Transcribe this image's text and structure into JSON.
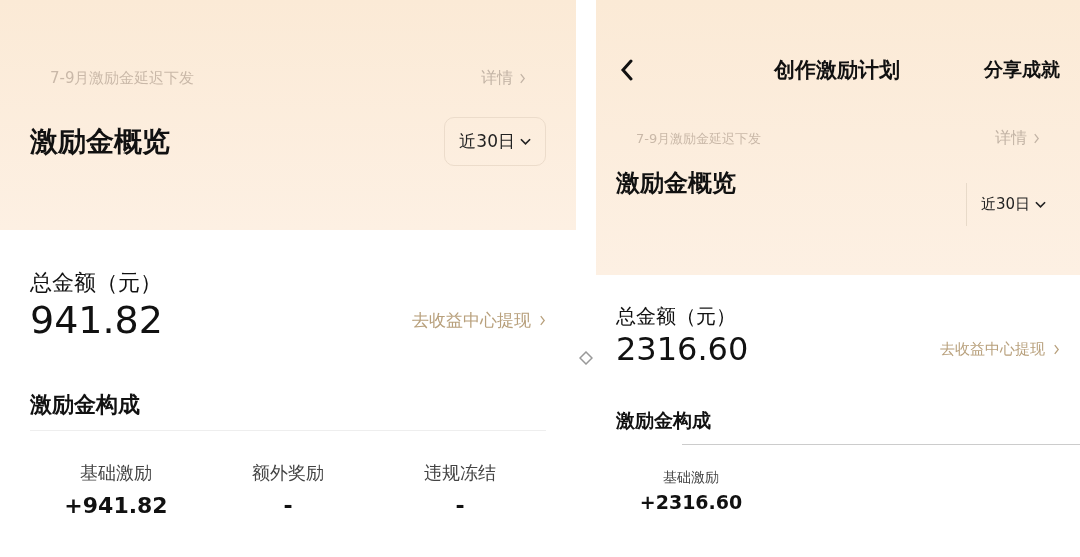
{
  "panels": [
    {
      "kind": "plain",
      "notice": {
        "text": "7-9月激励金延迟下发",
        "link": "详情"
      },
      "overview_title": "激励金概览",
      "period": "近30日",
      "total_label": "总金额（元）",
      "total": "941.82",
      "withdraw_link": "去收益中心提现",
      "section_title": "激励金构成",
      "breakdown": [
        {
          "label": "基础激励",
          "value": "+941.82"
        },
        {
          "label": "额外奖励",
          "value": "-"
        },
        {
          "label": "违规冻结",
          "value": "-"
        }
      ]
    },
    {
      "kind": "with_header",
      "header": {
        "title": "创作激励计划",
        "action": "分享成就"
      },
      "notice": {
        "text": "7-9月激励金延迟下发",
        "link": "详情"
      },
      "overview_title": "激励金概览",
      "period": "近30日",
      "total_label": "总金额（元）",
      "total": "2316.60",
      "withdraw_link": "去收益中心提现",
      "section_title": "激励金构成",
      "breakdown": [
        {
          "label": "基础激励",
          "value": "+2316.60"
        }
      ]
    }
  ]
}
